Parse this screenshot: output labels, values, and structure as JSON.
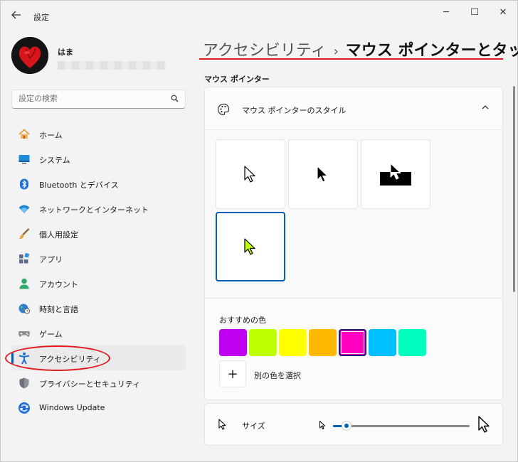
{
  "window": {
    "title": "設定",
    "back_icon": "back-arrow-icon",
    "minimize_glyph": "─",
    "maximize_glyph": "☐",
    "close_glyph": "✕"
  },
  "user": {
    "name": "はま"
  },
  "search": {
    "placeholder": "設定の検索"
  },
  "nav": {
    "items": [
      {
        "label": "ホーム",
        "icon": "home-icon"
      },
      {
        "label": "システム",
        "icon": "system-icon"
      },
      {
        "label": "Bluetooth とデバイス",
        "icon": "bluetooth-icon"
      },
      {
        "label": "ネットワークとインターネット",
        "icon": "wifi-icon"
      },
      {
        "label": "個人用設定",
        "icon": "brush-icon"
      },
      {
        "label": "アプリ",
        "icon": "apps-icon"
      },
      {
        "label": "アカウント",
        "icon": "account-icon"
      },
      {
        "label": "時刻と言語",
        "icon": "globe-icon"
      },
      {
        "label": "ゲーム",
        "icon": "gamepad-icon"
      },
      {
        "label": "アクセシビリティ",
        "icon": "accessibility-icon",
        "active": true
      },
      {
        "label": "プライバシーとセキュリティ",
        "icon": "shield-icon"
      },
      {
        "label": "Windows Update",
        "icon": "update-icon"
      }
    ]
  },
  "breadcrumb": {
    "parent": "アクセシビリティ",
    "separator": "›",
    "current": "マウス ポインターとタッチ"
  },
  "section": {
    "title": "マウス ポインター"
  },
  "pointer_style": {
    "title": "マウス ポインターのスタイル",
    "styles": [
      "white",
      "black",
      "inverted",
      "custom"
    ],
    "selected_style": "custom"
  },
  "colors": {
    "label": "おすすめの色",
    "swatches": [
      "#c000f0",
      "#bfff00",
      "#ffff00",
      "#ffb900",
      "#ff00bf",
      "#00bfff",
      "#00ffbf"
    ],
    "selected_index": 4,
    "add_label": "別の色を選択",
    "add_glyph": "+"
  },
  "size": {
    "label": "サイズ",
    "value_fraction": 0.1
  },
  "colors_theme": {
    "accent": "#005fb8",
    "annotation_red": "#e0191c",
    "custom_pointer": "#bfff00"
  }
}
